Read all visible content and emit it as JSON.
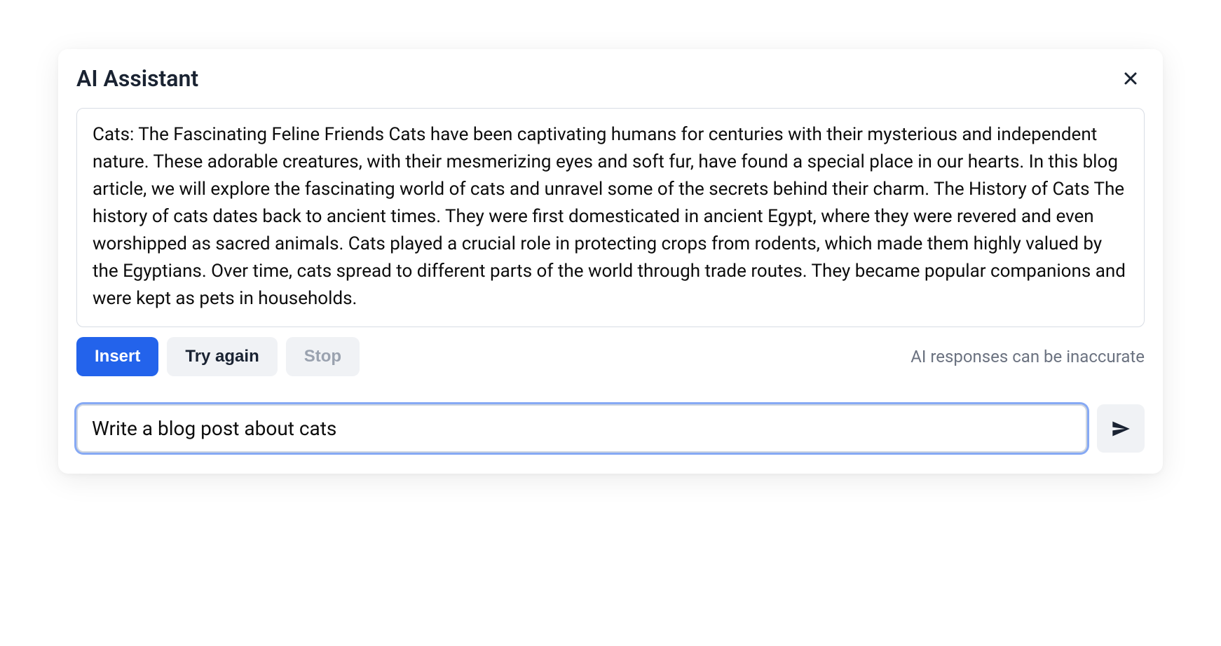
{
  "header": {
    "title": "AI Assistant"
  },
  "response": {
    "text": "Cats: The Fascinating Feline Friends Cats have been captivating humans for centuries with their mysterious and independent nature. These adorable creatures, with their mesmerizing eyes and soft fur, have found a special place in our hearts. In this blog article, we will explore the fascinating world of cats and unravel some of the secrets behind their charm. The History of Cats The history of cats dates back to ancient times. They were first domesticated in ancient Egypt, where they were revered and even worshipped as sacred animals. Cats played a crucial role in protecting crops from rodents, which made them highly valued by the Egyptians. Over time, cats spread to different parts of the world through trade routes. They became popular companions and were kept as pets in households."
  },
  "actions": {
    "insert_label": "Insert",
    "try_again_label": "Try again",
    "stop_label": "Stop",
    "disclaimer": "AI responses can be inaccurate"
  },
  "input": {
    "value": "Write a blog post about cats",
    "placeholder": ""
  }
}
